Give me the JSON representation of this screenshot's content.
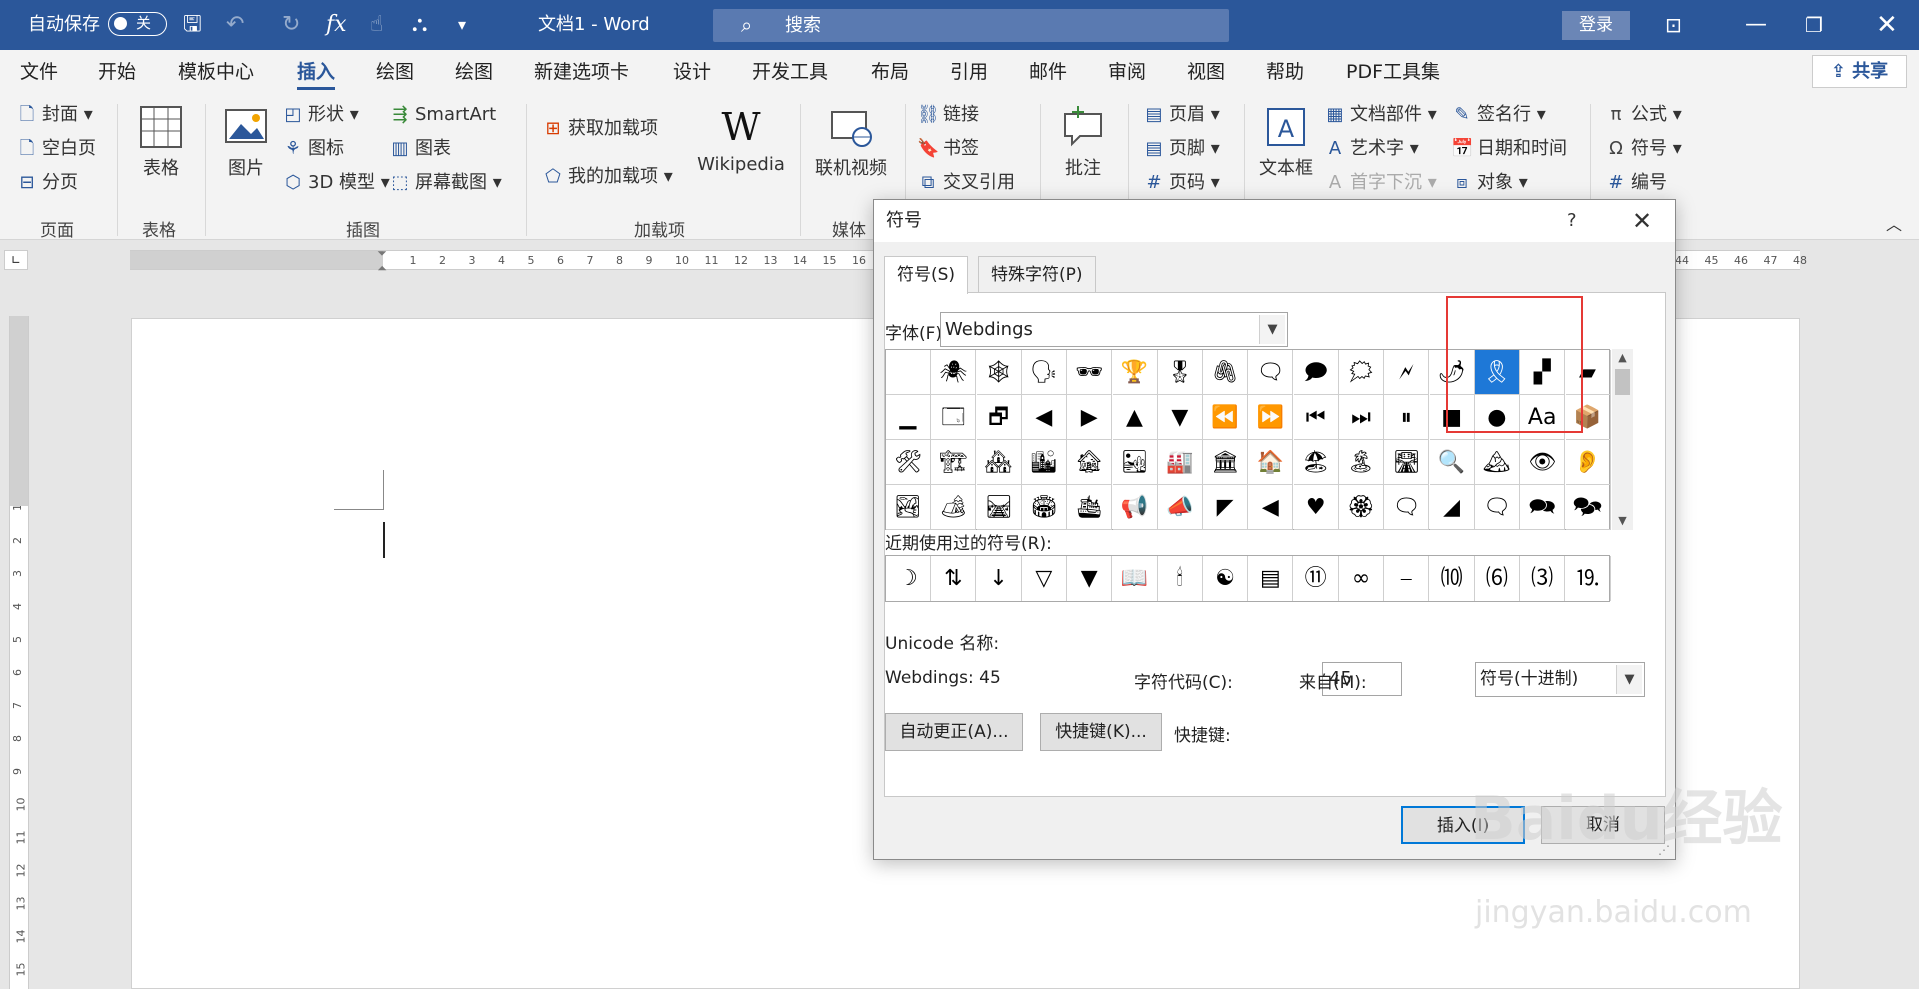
{
  "titlebar": {
    "autosave_label": "自动保存",
    "autosave_state": "关",
    "doc_title": "文档1  -  Word",
    "search_placeholder": "搜索",
    "login_label": "登录"
  },
  "ribbon_tabs": [
    "文件",
    "开始",
    "模板中心",
    "插入",
    "绘图",
    "绘图",
    "新建选项卡",
    "设计",
    "开发工具",
    "布局",
    "引用",
    "邮件",
    "审阅",
    "视图",
    "帮助",
    "PDF工具集"
  ],
  "active_tab": "插入",
  "share_label": "共享",
  "ribbon": {
    "pages": {
      "cover": "封面",
      "blank": "空白页",
      "break": "分页",
      "group": "页面"
    },
    "tables": {
      "table": "表格",
      "group": "表格"
    },
    "illustrations": {
      "picture": "图片",
      "shapes": "形状",
      "icons": "图标",
      "model3d": "3D 模型",
      "smartart": "SmartArt",
      "chart": "图表",
      "screenshot": "屏幕截图",
      "group": "插图"
    },
    "addins": {
      "get": "获取加载项",
      "my": "我的加载项",
      "wiki": "Wikipedia",
      "group": "加载项"
    },
    "media": {
      "video": "联机视频",
      "group": "媒体"
    },
    "links": {
      "link": "链接",
      "bookmark": "书签",
      "crossref": "交叉引用"
    },
    "comments": {
      "comment": "批注"
    },
    "header_footer": {
      "header": "页眉",
      "footer": "页脚",
      "pagenum": "页码"
    },
    "text": {
      "textbox": "文本框",
      "parts": "文档部件",
      "wordart": "艺术字",
      "dropcap": "首字下沉",
      "signature": "签名行",
      "datetime": "日期和时间",
      "object": "对象"
    },
    "symbols": {
      "equation": "公式",
      "symbol": "符号",
      "number": "编号"
    }
  },
  "dialog": {
    "title": "符号",
    "help": "?",
    "tabs": [
      "符号(S)",
      "特殊字符(P)"
    ],
    "font_label": "字体(F):",
    "font_value": "Webdings",
    "recent_label": "近期使用过的符号(R):",
    "recent_symbols": [
      "☽",
      "⇅",
      "↓",
      "▽",
      "▼",
      "📖",
      "🕯",
      "☯",
      "▤",
      "⑪",
      "∞",
      "⎯",
      "⑽",
      "⑹",
      "⑶",
      "⒚"
    ],
    "unicode_label": "Unicode 名称:",
    "unicode_value": "Webdings: 45",
    "code_label": "字符代码(C):",
    "code_value": "45",
    "from_label": "来自(M):",
    "from_value": "符号(十进制)",
    "autocorrect": "自动更正(A)...",
    "shortcut_btn": "快捷键(K)...",
    "shortcut_label": "快捷键:",
    "insert": "插入(I)",
    "cancel": "取消",
    "symbols": [
      [
        "",
        "🕷",
        "🕸",
        "🗣",
        "🕶",
        "🏆",
        "🎖",
        "🖇",
        "🗨",
        "🗩",
        "🗯",
        "🗲",
        "🌶",
        "🎗",
        "▞",
        "▰"
      ],
      [
        "▁",
        "🗔",
        "🗗",
        "◀",
        "▶",
        "▲",
        "▼",
        "⏪",
        "⏩",
        "⏮",
        "⏭",
        "⏸",
        "■",
        "●",
        "Aa",
        "📦"
      ],
      [
        "🛠",
        "🏗",
        "🏘",
        "🏙",
        "🏚",
        "🏜",
        "🏭",
        "🏛",
        "🏠",
        "🏖",
        "🏝",
        "🛣",
        "🔍",
        "🏔",
        "👁",
        "👂"
      ],
      [
        "🏞",
        "🏕",
        "🛤",
        "🏟",
        "🛳",
        "📢",
        "📣",
        "◤",
        "◀",
        "♥",
        "🏵",
        "🗨",
        "◢",
        "🗨",
        "🗪",
        "🗫"
      ]
    ],
    "selected": [
      0,
      13
    ]
  },
  "watermark": {
    "brand": "Baidu经验",
    "url": "jingyan.baidu.com"
  },
  "colors": {
    "titlebar": "#2b579a",
    "accent": "#2b579a",
    "selection": "#1e78d7",
    "highlight": "#e53935"
  }
}
